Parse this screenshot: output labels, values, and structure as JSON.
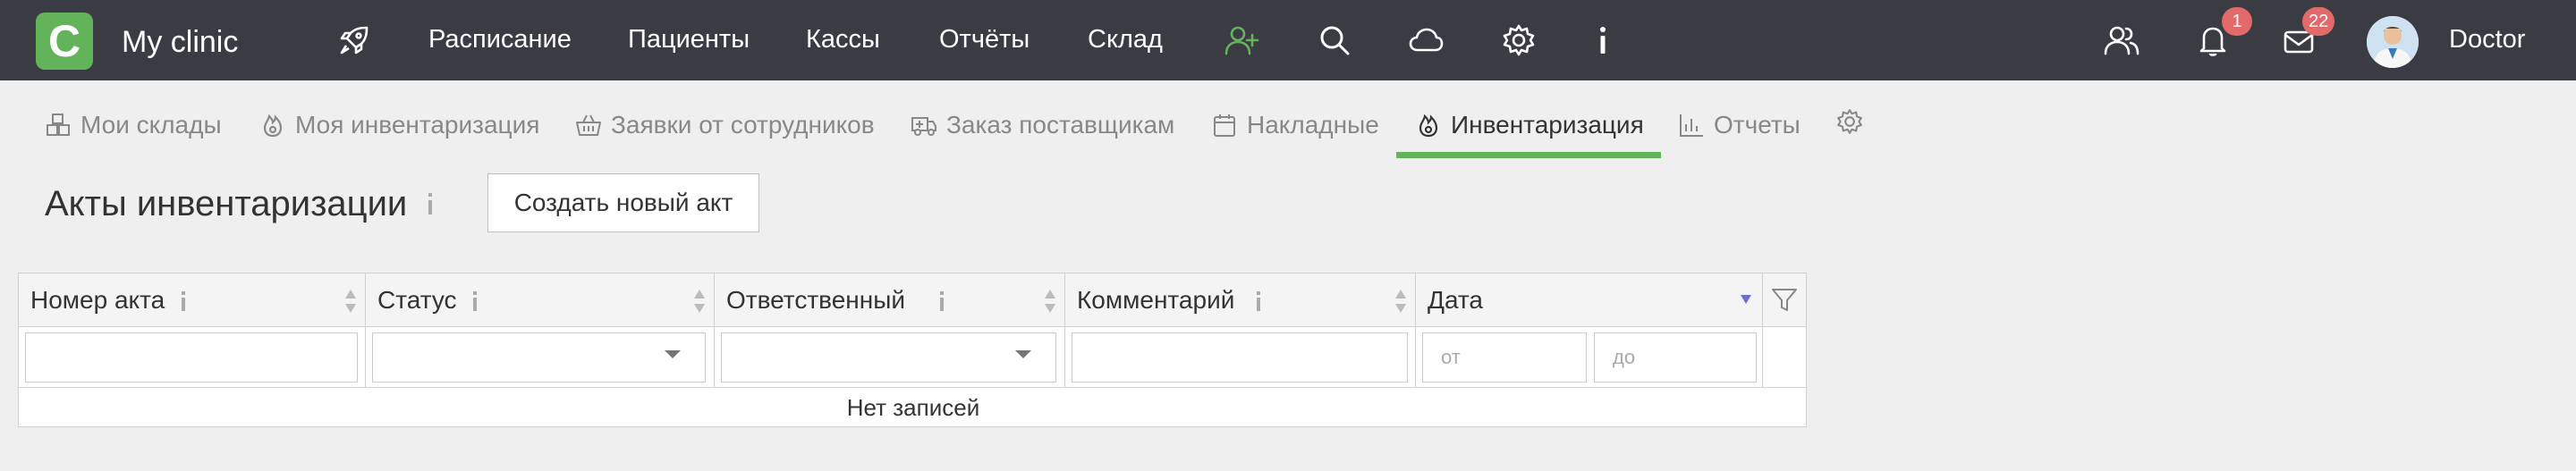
{
  "app": {
    "logo_letter": "C",
    "clinic_name": "My clinic",
    "user_name": "Doctor"
  },
  "nav": {
    "items": [
      "Расписание",
      "Пациенты",
      "Кассы",
      "Отчёты",
      "Склад"
    ],
    "notifications_count": "1",
    "messages_count": "22"
  },
  "tabs": [
    {
      "label": "Мои склады",
      "icon": "cubes-icon"
    },
    {
      "label": "Моя инвентаризация",
      "icon": "fire-icon"
    },
    {
      "label": "Заявки от сотрудников",
      "icon": "basket-icon"
    },
    {
      "label": "Заказ поставщикам",
      "icon": "truck-icon"
    },
    {
      "label": "Накладные",
      "icon": "calendar-icon"
    },
    {
      "label": "Инвентаризация",
      "icon": "fire-icon",
      "active": true
    },
    {
      "label": "Отчеты",
      "icon": "chart-icon"
    }
  ],
  "page": {
    "title": "Акты инвентаризации",
    "create_button": "Создать новый акт"
  },
  "table": {
    "columns": [
      "Номер акта",
      "Статус",
      "Ответственный",
      "Комментарий",
      "Дата"
    ],
    "date_from_placeholder": "от",
    "date_to_placeholder": "до",
    "empty_text": "Нет записей"
  },
  "colors": {
    "topbar": "#3b3b44",
    "accent_green": "#62b35a",
    "badge_red": "#e26a6a",
    "sort_active": "#6b6fd4"
  }
}
